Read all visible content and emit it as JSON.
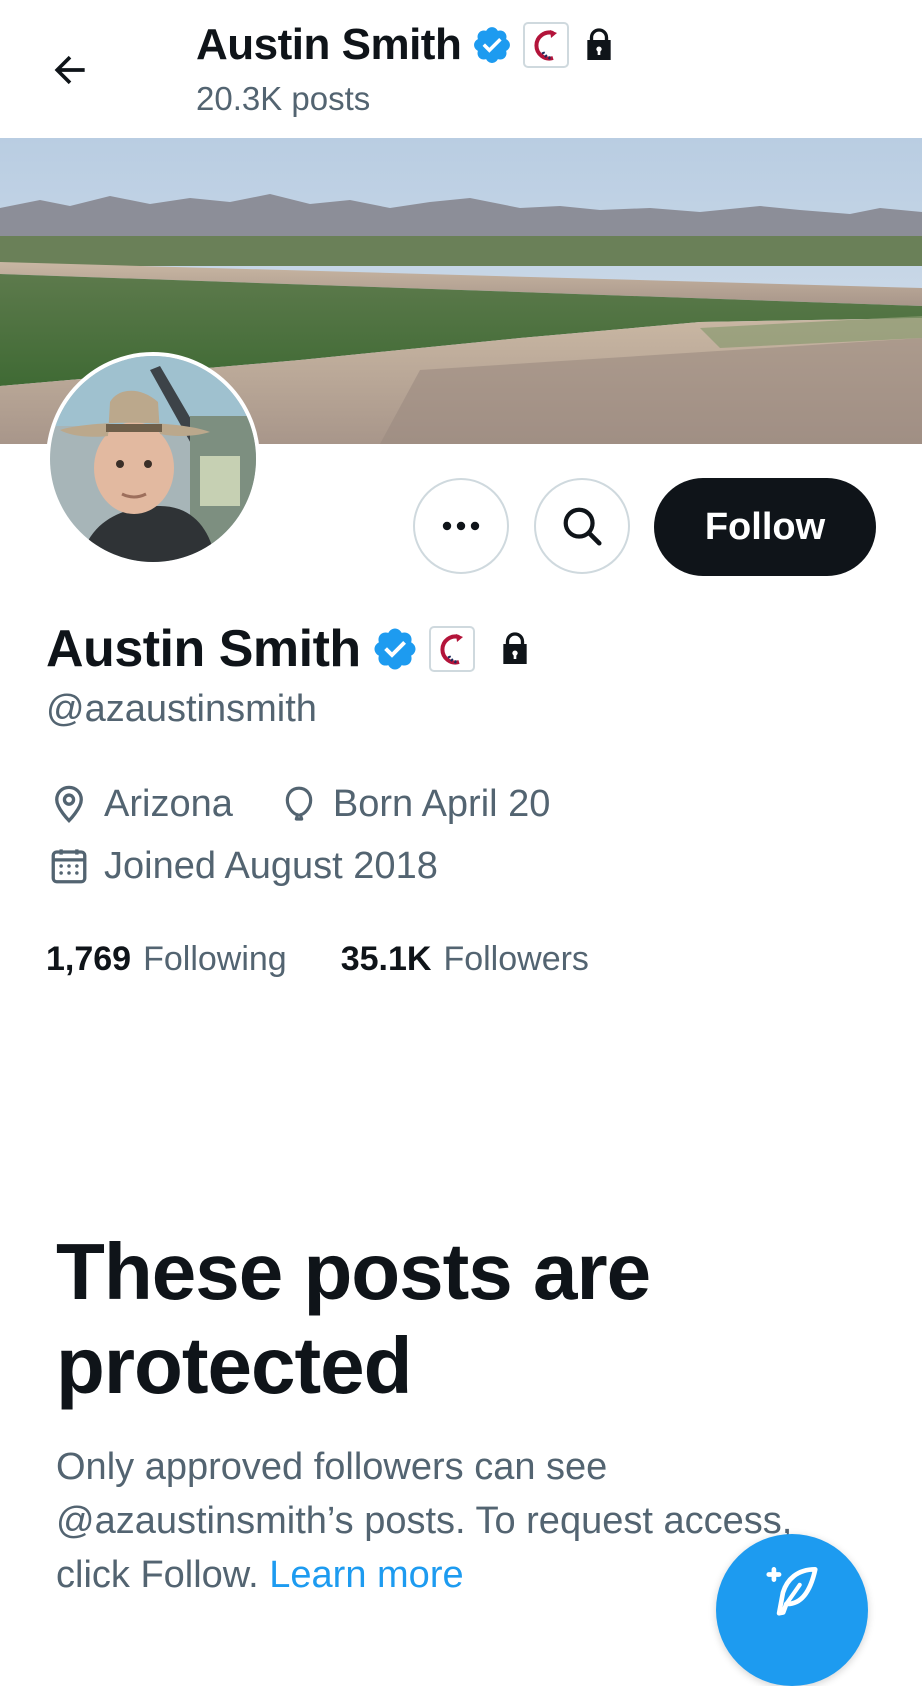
{
  "header": {
    "display_name": "Austin Smith",
    "posts_count": "20.3K posts",
    "back_icon": "arrow-left-icon",
    "badges": [
      "verified-badge-icon",
      "affiliate-badge-icon",
      "lock-icon"
    ]
  },
  "actions": {
    "more_icon": "more-horizontal-icon",
    "search_icon": "search-icon",
    "follow_label": "Follow"
  },
  "profile": {
    "display_name": "Austin Smith",
    "handle": "@azaustinsmith",
    "location_icon": "location-pin-icon",
    "location": "Arizona",
    "birthday_icon": "balloon-icon",
    "birthday": "Born April 20",
    "joined_icon": "calendar-icon",
    "joined": "Joined August 2018",
    "following_count": "1,769",
    "following_label": "Following",
    "followers_count": "35.1K",
    "followers_label": "Followers"
  },
  "protected": {
    "title": "These posts are protected",
    "body": "Only approved followers can see @azaustinsmith’s posts. To request access, click Follow.",
    "learn_more": "Learn more"
  },
  "fab": {
    "icon": "compose-feather-icon"
  },
  "colors": {
    "accent": "#1d9bf0",
    "text_primary": "#0f1419",
    "text_secondary": "#536471",
    "follow_button_bg": "#0f1419"
  }
}
